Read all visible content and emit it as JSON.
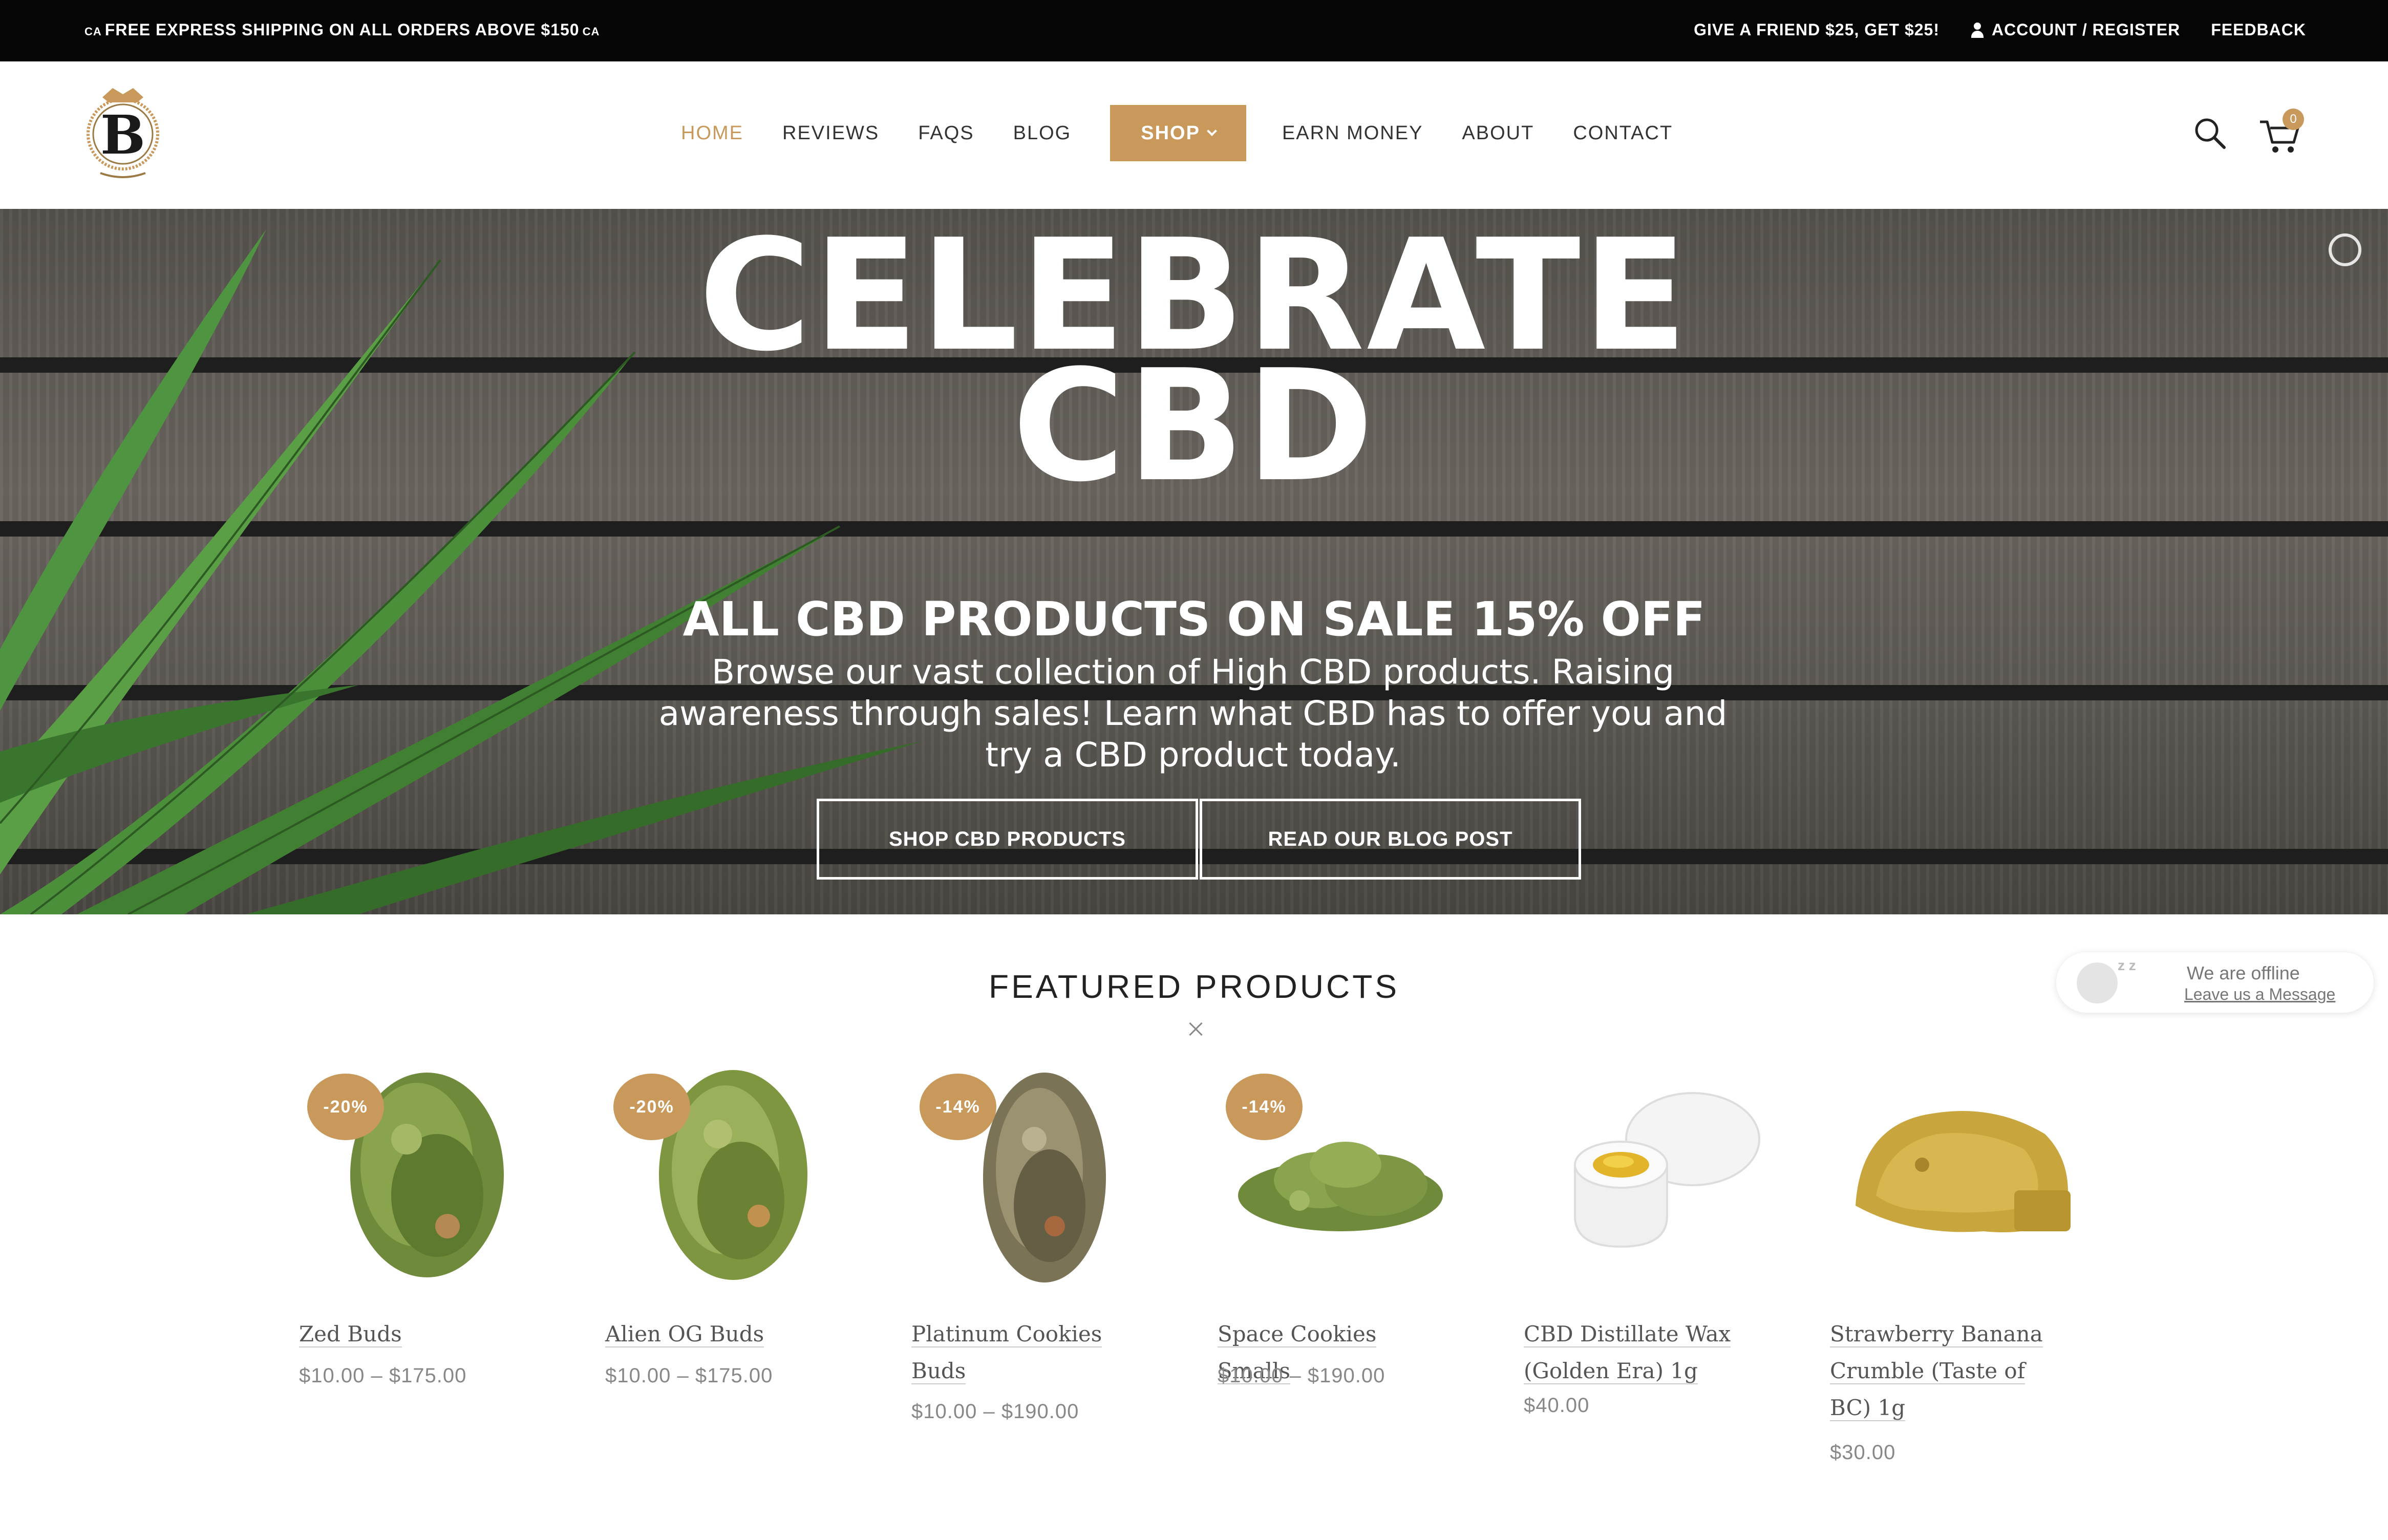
{
  "topbar": {
    "promo": "FREE EXPRESS SHIPPING ON ALL ORDERS ABOVE $150",
    "promo_prefix": "CA",
    "promo_suffix": "CA",
    "refer": "GIVE A FRIEND $25, GET $25!",
    "account": "ACCOUNT / REGISTER",
    "feedback": "FEEDBACK"
  },
  "nav": {
    "items": [
      "HOME",
      "REVIEWS",
      "FAQS",
      "BLOG",
      "SHOP",
      "EARN MONEY",
      "ABOUT",
      "CONTACT"
    ],
    "active": "HOME",
    "accent_color": "#c8995a"
  },
  "cart": {
    "count": "0"
  },
  "hero": {
    "title_line1": "CELEBRATE",
    "title_line2": "CBD",
    "sale": "ALL CBD PRODUCTS ON SALE 15% OFF",
    "desc": "Browse our vast collection of High CBD products. Raising awareness through sales! Learn what CBD has to offer you and try a CBD product today.",
    "btn_shop": "SHOP CBD PRODUCTS",
    "btn_blog": "READ OUR BLOG POST"
  },
  "featured": {
    "title": "FEATURED PRODUCTS",
    "products": [
      {
        "name": "Zed Buds",
        "price": "$10.00 – $175.00",
        "badge": "-20%",
        "kind": "bud"
      },
      {
        "name": "Alien OG Buds",
        "price": "$10.00 – $175.00",
        "badge": "-20%",
        "kind": "bud"
      },
      {
        "name": "Platinum Cookies Buds",
        "price": "$10.00 – $190.00",
        "badge": "-14%",
        "kind": "bud"
      },
      {
        "name": "Space Cookies Smalls",
        "price": "$10.00 – $190.00",
        "badge": "-14%",
        "kind": "smalls"
      },
      {
        "name": "CBD Distillate Wax (Golden Era) 1g",
        "price": "$40.00",
        "badge": "",
        "kind": "wax"
      },
      {
        "name": "Strawberry Banana Crumble (Taste of BC) 1g",
        "price": "$30.00",
        "badge": "",
        "kind": "crumble"
      }
    ]
  },
  "chat": {
    "line1": "We are offline",
    "line2": "Leave us a Message"
  }
}
